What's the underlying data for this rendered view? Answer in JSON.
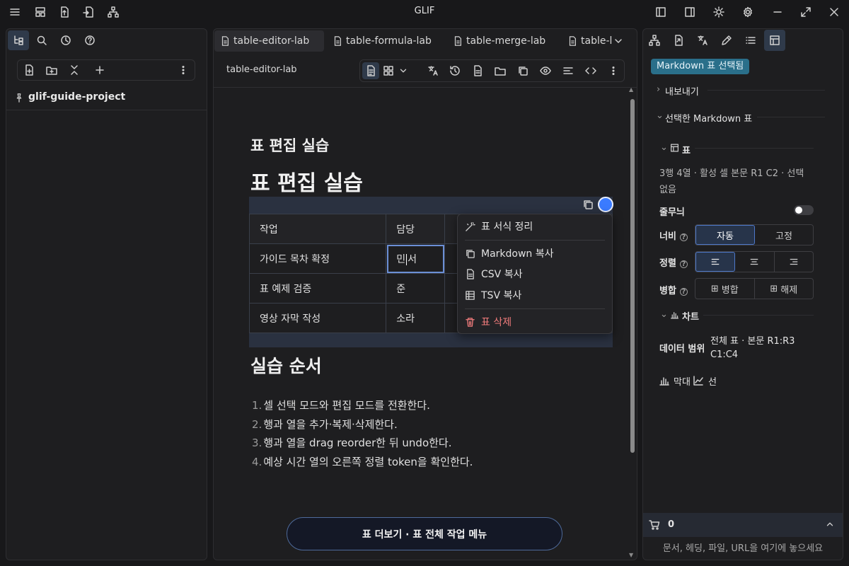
{
  "app": {
    "title": "GLIF"
  },
  "left": {
    "project_name": "glif-guide-project"
  },
  "tabs": [
    {
      "label": "table-editor-lab"
    },
    {
      "label": "table-formula-lab"
    },
    {
      "label": "table-merge-lab"
    },
    {
      "label": "table-l"
    }
  ],
  "editor": {
    "breadcrumb": "table-editor-lab",
    "h2": "표 편집 실습",
    "h1": "표 편집 실습",
    "table": {
      "header": [
        "작업",
        "담당",
        ""
      ],
      "rows": [
        [
          "가이드 목차 확정",
          "민서",
          ""
        ],
        [
          "표 예제 검증",
          "준",
          ""
        ],
        [
          "영상 자막 작성",
          "소라",
          ""
        ]
      ],
      "active_cell_before_caret": "민",
      "active_cell_after_caret": "서"
    },
    "context_menu": {
      "format": "표 서식 정리",
      "copy_md": "Markdown 복사",
      "copy_csv": "CSV 복사",
      "copy_tsv": "TSV 복사",
      "delete": "표 삭제"
    },
    "section_title": "실습 순서",
    "steps": [
      {
        "num": "1.",
        "text": "셀 선택 모드와 편집 모드를 전환한다."
      },
      {
        "num": "2.",
        "text": "행과 열을 추가·복제·삭제한다."
      },
      {
        "num": "3.",
        "text": "행과 열을 drag reorder한 뒤 undo한다."
      },
      {
        "num": "4.",
        "text": "예상 시간 열의 오른쪽 정렬 token을 확인한다."
      }
    ],
    "more_button": "표 더보기 · 표 전체 작업 메뉴"
  },
  "right": {
    "badge": "Markdown 표 선택됨",
    "export": "내보내기",
    "selected_table": "선택한 Markdown 표",
    "table_section": "표",
    "table_info": "3행 4열 · 활성 셀 본문 R1 C2 · 선택 없음",
    "border_label": "줄무늬",
    "width_label": "너비",
    "width_options": [
      "자동",
      "고정"
    ],
    "align_label": "정렬",
    "merge_label": "병합",
    "merge_options": [
      "병합",
      "해제"
    ],
    "chart_section": "차트",
    "data_range_label": "데이터 범위",
    "data_range_value_1": "전체 표 · 본문 R1:R3",
    "data_range_value_2": "C1:C4",
    "chart_bar": "막대",
    "chart_line": "선",
    "cart_count": "0",
    "drop_hint": "문서, 헤딩, 파일, URL을 여기에 놓으세요"
  },
  "colors": {
    "accent": "#3b7bff",
    "badge": "#2a6f8a",
    "danger": "#ef7b7b"
  }
}
